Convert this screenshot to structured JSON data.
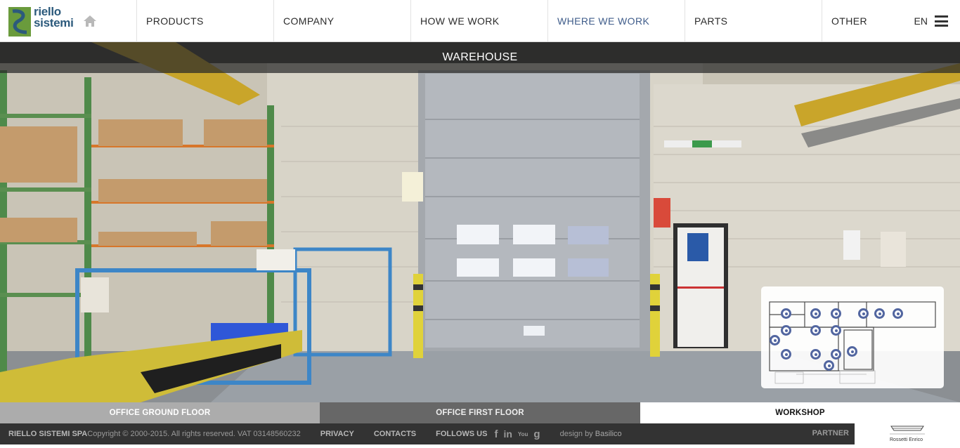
{
  "header": {
    "logo_line1": "riello",
    "logo_line2": "sistemi",
    "nav": [
      {
        "label": "PRODUCTS"
      },
      {
        "label": "COMPANY"
      },
      {
        "label": "HOW WE WORK"
      },
      {
        "label": "WHERE WE WORK",
        "active": true
      },
      {
        "label": "PARTS"
      },
      {
        "label": "OTHER"
      }
    ],
    "language": "EN",
    "icons": [
      "home-icon",
      "hamburger-menu-icon"
    ]
  },
  "hero": {
    "title": "WAREHOUSE"
  },
  "minimap": {
    "hotspot_count": 15,
    "hotspot_color": "#5266a0"
  },
  "tabs": [
    {
      "label": "OFFICE GROUND FLOOR"
    },
    {
      "label": "OFFICE FIRST FLOOR"
    },
    {
      "label": "WORKSHOP",
      "active": true
    }
  ],
  "footer": {
    "company": "RIELLO SISTEMI SPA",
    "copyright": " Copyright © 2000-2015. All rights reserved. VAT 03148560232",
    "privacy": "PRIVACY",
    "contacts": "CONTACTS",
    "follow_us": "FOLLOWS US",
    "social": [
      {
        "icon": "facebook-icon",
        "glyph": "f"
      },
      {
        "icon": "linkedin-icon",
        "glyph": "in"
      },
      {
        "icon": "youtube-icon",
        "glyph": "You"
      },
      {
        "icon": "googleplus-icon",
        "glyph": "g"
      }
    ],
    "design_by": "design by ",
    "designer": "Basilico",
    "partner": "PARTNER",
    "partner_name": "Rossetti Enrico"
  },
  "colors": {
    "accent": "#3f5c8a",
    "logo_green": "#6a9b3c",
    "logo_blue": "#2c5a7c",
    "footer_bg": "#333333"
  }
}
